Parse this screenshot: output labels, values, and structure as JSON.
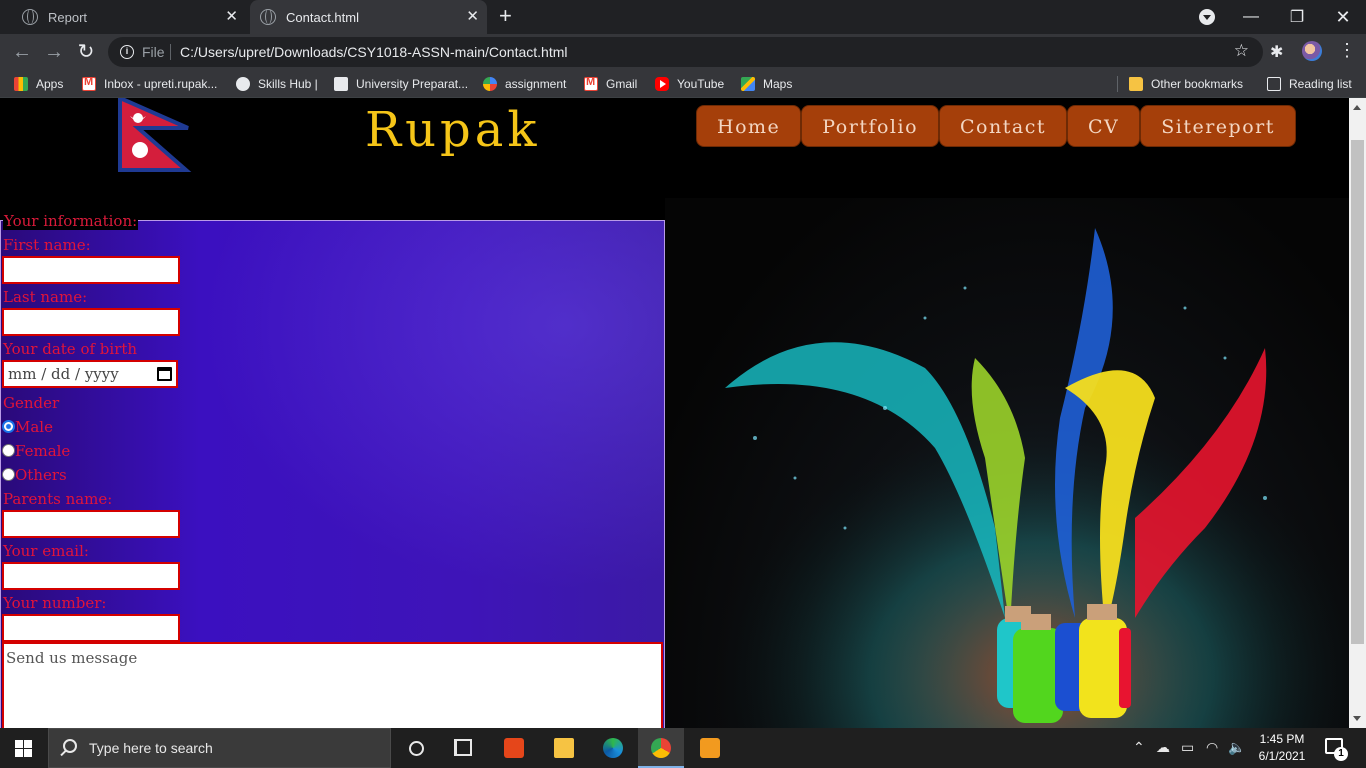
{
  "browser": {
    "tabs": [
      {
        "title": "Report",
        "active": false
      },
      {
        "title": "Contact.html",
        "active": true
      }
    ],
    "address": {
      "scheme_label": "File",
      "url": "C:/Users/upret/Downloads/CSY1018-ASSN-main/Contact.html"
    },
    "bookmarks": [
      {
        "label": "Apps",
        "icon": "apps-grid-icon"
      },
      {
        "label": "Inbox - upreti.rupak...",
        "icon": "gmail-icon"
      },
      {
        "label": "Skills Hub |",
        "icon": "globe-icon"
      },
      {
        "label": "University Preparat...",
        "icon": "university-icon"
      },
      {
        "label": "assignment",
        "icon": "assignment-icon"
      },
      {
        "label": "Gmail",
        "icon": "gmail-icon"
      },
      {
        "label": "YouTube",
        "icon": "youtube-icon"
      },
      {
        "label": "Maps",
        "icon": "maps-icon"
      }
    ],
    "other_bookmarks": "Other bookmarks",
    "reading_list": "Reading list"
  },
  "page": {
    "site_title": "Rupak",
    "nav": [
      "Home",
      "Portfolio",
      "Contact",
      "CV",
      "Sitereport"
    ],
    "form": {
      "legend": "Your information:",
      "first_name_label": "First name:",
      "last_name_label": "Last name:",
      "dob_label": "Your date of birth",
      "dob_placeholder": "mm / dd / yyyy",
      "gender_label": "Gender",
      "gender_options": [
        "Male",
        "Female",
        "Others"
      ],
      "gender_selected": "Male",
      "parents_label": "Parents name:",
      "email_label": "Your email:",
      "number_label": "Your number:",
      "message_placeholder": "Send us message"
    },
    "colors": {
      "title": "#f5c518",
      "nav_bg": "#a53f0a",
      "label": "#e0143a",
      "input_border": "#d40000",
      "form_bg": "#3b10c0"
    }
  },
  "taskbar": {
    "search_placeholder": "Type here to search",
    "time": "1:45 PM",
    "date": "6/1/2021",
    "notification_count": "1"
  }
}
